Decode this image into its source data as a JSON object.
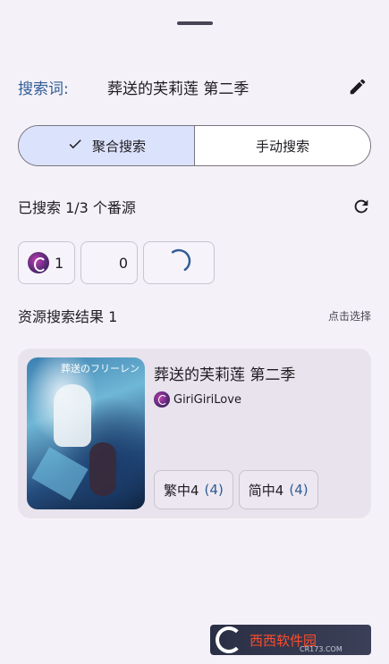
{
  "sheet": {
    "keyword_label": "搜索词:",
    "keyword_value": "葬送的芙莉莲 第二季"
  },
  "mode_toggle": {
    "aggregate_label": "聚合搜索",
    "manual_label": "手动搜索",
    "selected": "aggregate"
  },
  "status": {
    "text": "已搜索 1/3 个番源"
  },
  "sources": [
    {
      "count": "1",
      "icon": "girigiri-logo"
    },
    {
      "count": "0"
    },
    {
      "state": "loading"
    }
  ],
  "results": {
    "title": "资源搜索结果 1",
    "hint": "点击选择",
    "items": [
      {
        "title": "葬送的芙莉莲 第二季",
        "source": "GiriGiriLove",
        "poster_text": "葬送のフリーレン",
        "tags": [
          {
            "label": "繁中4",
            "count": "(4)"
          },
          {
            "label": "简中4",
            "count": "(4)"
          }
        ]
      }
    ]
  },
  "watermark": {
    "text": "西西软件园",
    "url": "CR173.COM"
  },
  "colors": {
    "accent": "#2f5d96",
    "selected_segment": "#dbe2fb",
    "background": "#f5f1f8",
    "card": "#e8e3ec"
  }
}
